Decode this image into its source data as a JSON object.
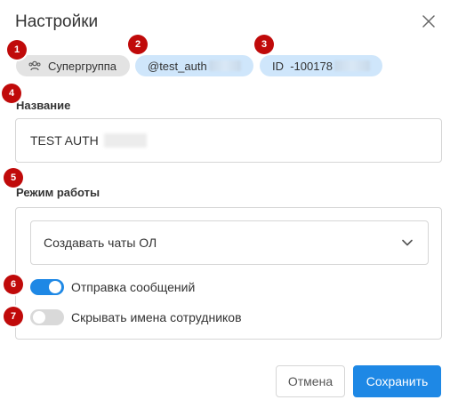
{
  "dialog": {
    "title": "Настройки"
  },
  "chips": {
    "group": "Супергруппа",
    "username": "@test_auth",
    "id": "ID  -100178"
  },
  "badges": [
    "1",
    "2",
    "3",
    "4",
    "5",
    "6",
    "7"
  ],
  "name_field": {
    "label": "Название",
    "value": "TEST AUTH"
  },
  "mode": {
    "label": "Режим работы",
    "selected": "Создавать чаты ОЛ"
  },
  "toggles": [
    {
      "label": "Отправка сообщений",
      "on": true
    },
    {
      "label": "Скрывать имена сотрудников",
      "on": false
    }
  ],
  "buttons": {
    "cancel": "Отмена",
    "save": "Сохранить"
  },
  "colors": {
    "accent": "#1e88e5",
    "badge": "#c00a0a",
    "chip_blue": "#cfe6fb",
    "chip_gray": "#e3e3e3"
  },
  "icons": {
    "close": "close-icon",
    "group": "users-icon",
    "select": "chevron-down-icon"
  }
}
